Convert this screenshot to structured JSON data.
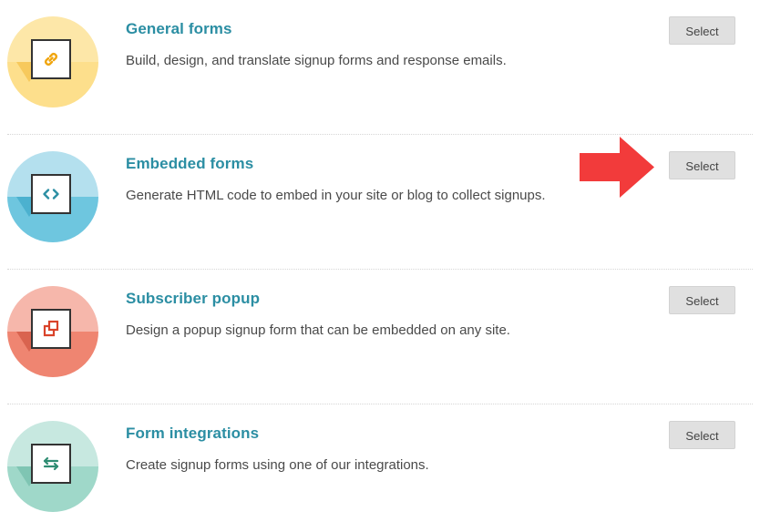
{
  "rows": [
    {
      "title": "General forms",
      "description": "Build, design, and translate signup forms and response emails.",
      "button_label": "Select",
      "icon": "link-icon",
      "colors": {
        "top": "#fde7a8",
        "bottom": "#fddf8c",
        "fold": "#f7c95c",
        "icon": "#f0a50f"
      }
    },
    {
      "title": "Embedded forms",
      "description": "Generate HTML code to embed in your site or blog to collect signups.",
      "button_label": "Select",
      "icon": "code-icon",
      "colors": {
        "top": "#b4e0ee",
        "bottom": "#6ec6df",
        "fold": "#4cb1cf",
        "icon": "#2b8ea3"
      }
    },
    {
      "title": "Subscriber popup",
      "description": "Design a popup signup form that can be embedded on any site.",
      "button_label": "Select",
      "icon": "popup-icon",
      "colors": {
        "top": "#f6b7ab",
        "bottom": "#ef8571",
        "fold": "#d9634f",
        "icon": "#d9432a"
      }
    },
    {
      "title": "Form integrations",
      "description": "Create signup forms using one of our integrations.",
      "button_label": "Select",
      "icon": "swap-arrows-icon",
      "colors": {
        "top": "#c7e8e0",
        "bottom": "#9fd8c9",
        "fold": "#7fc5b3",
        "icon": "#2f8d73"
      }
    }
  ],
  "annotation": {
    "icon": "red-arrow-icon",
    "color": "#f23b3b"
  }
}
